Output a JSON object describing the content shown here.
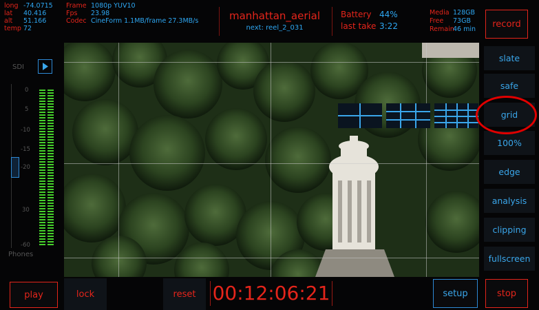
{
  "top": {
    "gps": [
      {
        "label": "long",
        "value": "-74.0715"
      },
      {
        "label": "lat",
        "value": "40.416"
      },
      {
        "label": "alt",
        "value": "51.166"
      },
      {
        "label": "temp",
        "value": "72"
      }
    ],
    "format": [
      {
        "label": "Frame",
        "value": "1080p YUV10"
      },
      {
        "label": "Fps",
        "value": "23.98"
      },
      {
        "label": "Codec",
        "value": "CineForm 1.1MB/frame 27.3MB/s"
      }
    ],
    "clip_name": "manhattan_aerial",
    "next_clip": "next: reel_2_031",
    "battery": {
      "label": "Battery",
      "value": "44%"
    },
    "last_take": {
      "label": "last take",
      "value": "3:22"
    },
    "media": [
      {
        "label": "Media",
        "value": "128GB"
      },
      {
        "label": "Free",
        "value": "73GB"
      },
      {
        "label": "Remain",
        "value": "46 min"
      }
    ]
  },
  "buttons": {
    "record": "record",
    "play": "play",
    "lock": "lock",
    "reset": "reset",
    "setup": "setup",
    "stop": "stop"
  },
  "timecode": "00:12:06:21",
  "sidebar": [
    {
      "label": "slate"
    },
    {
      "label": "safe"
    },
    {
      "label": "grid",
      "highlighted": true
    },
    {
      "label": "100%"
    },
    {
      "label": "edge"
    },
    {
      "label": "analysis"
    },
    {
      "label": "clipping"
    },
    {
      "label": "fullscreen"
    }
  ],
  "meter": {
    "input_label": "SDI",
    "scale": [
      "0",
      "5",
      "-10",
      "-15",
      "-20",
      "30",
      "-60"
    ],
    "output_label": "Phones"
  },
  "colors": {
    "accent_red": "#e5251b",
    "accent_blue": "#2ea7f2",
    "highlight_circle": "#e00000"
  }
}
